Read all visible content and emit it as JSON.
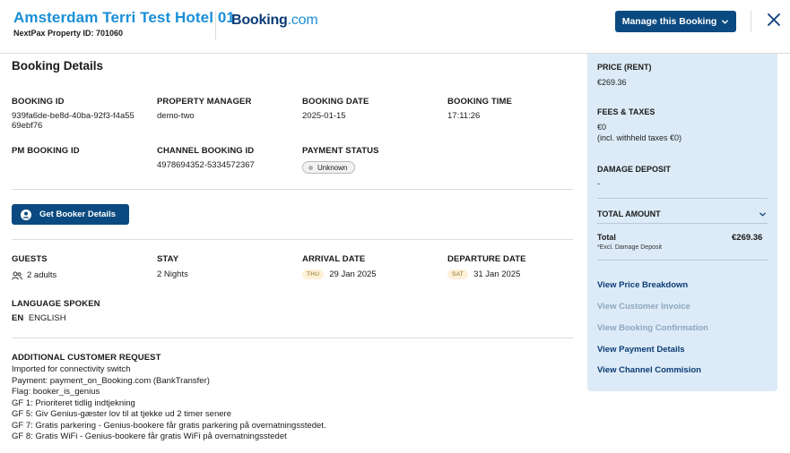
{
  "header": {
    "hotel_name": "Amsterdam Terri Test Hotel 01",
    "property_id": "NextPax Property ID: 701060",
    "brand_main": "Booking",
    "brand_suffix": ".com",
    "manage_label": "Manage this Booking"
  },
  "details": {
    "title": "Booking Details",
    "booking_id_label": "BOOKING ID",
    "booking_id": "939fa6de-be8d-40ba-92f3-f4a5569ebf76",
    "pm_label": "PROPERTY MANAGER",
    "pm": "demo-two",
    "booking_date_label": "BOOKING DATE",
    "booking_date": "2025-01-15",
    "booking_time_label": "BOOKING TIME",
    "booking_time": "17:11:26",
    "pm_booking_id_label": "PM BOOKING ID",
    "channel_booking_id_label": "CHANNEL BOOKING ID",
    "channel_booking_id": "4978694352-5334572367",
    "payment_status_label": "PAYMENT STATUS",
    "payment_status": "Unknown",
    "get_booker_label": "Get Booker Details",
    "guests_label": "GUESTS",
    "guests": "2 adults",
    "stay_label": "STAY",
    "stay": "2 Nights",
    "arrival_label": "ARRIVAL DATE",
    "arrival_day": "THU",
    "arrival_date": "29 Jan 2025",
    "departure_label": "DEPARTURE DATE",
    "departure_day": "SAT",
    "departure_date": "31 Jan 2025",
    "language_label": "LANGUAGE SPOKEN",
    "language_code": "EN",
    "language": "ENGLISH",
    "request_label": "ADDITIONAL CUSTOMER REQUEST",
    "request_lines": [
      "Imported for connectivity switch",
      "Payment: payment_on_Booking.com (BankTransfer)",
      "Flag: booker_is_genius",
      "GF 1: Prioriteret tidlig indtjekning",
      "GF 5: Giv Genius-gæster lov til at tjekke ud 2 timer senere",
      "GF 7: Gratis parkering - Genius-bookere får gratis parkering på overnatningsstedet.",
      "GF 8: Gratis WiFi - Genius-bookere får gratis WiFi på overnatningsstedet"
    ]
  },
  "summary": {
    "price_label": "PRICE (RENT)",
    "price": "€269.36",
    "fees_label": "FEES & TAXES",
    "fees": "€0",
    "fees_note": "(incl. withheld taxes €0)",
    "deposit_label": "DAMAGE DEPOSIT",
    "deposit": "-",
    "total_amount_label": "TOTAL AMOUNT",
    "total_label": "Total",
    "total": "€269.36",
    "total_note": "*Excl. Damage Deposit",
    "links": [
      {
        "label": "View Price Breakdown",
        "muted": false
      },
      {
        "label": "View Customer Invoice",
        "muted": true
      },
      {
        "label": "View Booking Confirmation",
        "muted": true
      },
      {
        "label": "View Payment Details",
        "muted": false
      },
      {
        "label": "View Channel Commision",
        "muted": false
      }
    ]
  },
  "colors": {
    "primary_button": "#0b4a80",
    "hotel_title": "#1a8fd6",
    "sidebar_bg": "#dcebf7",
    "link": "#0b3b75",
    "link_muted": "#8fa6bd"
  }
}
